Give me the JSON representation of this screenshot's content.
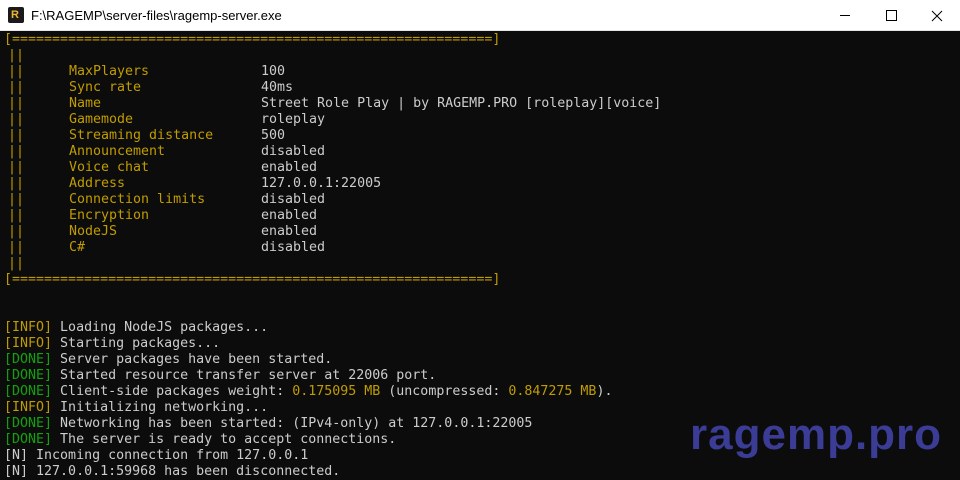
{
  "window": {
    "title": "F:\\RAGEMP\\server-files\\ragemp-server.exe",
    "icon_letter": "R"
  },
  "config_box": {
    "border": "[============================================================]",
    "left_bar": "||",
    "rows": [
      {
        "key": "MaxPlayers",
        "value": "100"
      },
      {
        "key": "Sync rate",
        "value": "40ms"
      },
      {
        "key": "Name",
        "value": "Street Role Play | by RAGEMP.PRO [roleplay][voice]"
      },
      {
        "key": "Gamemode",
        "value": "roleplay"
      },
      {
        "key": "Streaming distance",
        "value": "500"
      },
      {
        "key": "Announcement",
        "value": "disabled"
      },
      {
        "key": "Voice chat",
        "value": "enabled"
      },
      {
        "key": "Address",
        "value": "127.0.0.1:22005"
      },
      {
        "key": "Connection limits",
        "value": "disabled"
      },
      {
        "key": "Encryption",
        "value": "enabled"
      },
      {
        "key": "NodeJS",
        "value": "enabled"
      },
      {
        "key": "C#",
        "value": "disabled"
      }
    ]
  },
  "log": [
    {
      "tag": "[INFO]",
      "text": " Loading NodeJS packages..."
    },
    {
      "tag": "[INFO]",
      "text": " Starting packages..."
    },
    {
      "tag": "[DONE]",
      "text": " Server packages have been started."
    },
    {
      "tag": "[DONE]",
      "text": " Started resource transfer server at 22006 port."
    },
    {
      "tag": "[DONE]",
      "text": " Client-side packages weight: ",
      "v1": "0.175095 MB",
      "mid": " (uncompressed: ",
      "v2": "0.847275 MB",
      "end": ")."
    },
    {
      "tag": "[INFO]",
      "text": " Initializing networking..."
    },
    {
      "tag": "[DONE]",
      "text": " Networking has been started: (IPv4-only) at 127.0.0.1:22005"
    },
    {
      "tag": "[DONE]",
      "text": " The server is ready to accept connections."
    },
    {
      "tag": "[N]",
      "text": " Incoming connection from 127.0.0.1"
    },
    {
      "tag": "[N]",
      "text": " 127.0.0.1:59968 has been disconnected."
    }
  ],
  "colors": {
    "background": "#0c0c0c",
    "text": "#cccccc",
    "key": "#c19c00",
    "info": "#c19c00",
    "done": "#13a10e",
    "watermark": "#3a3c96"
  },
  "watermark": "ragemp.pro"
}
